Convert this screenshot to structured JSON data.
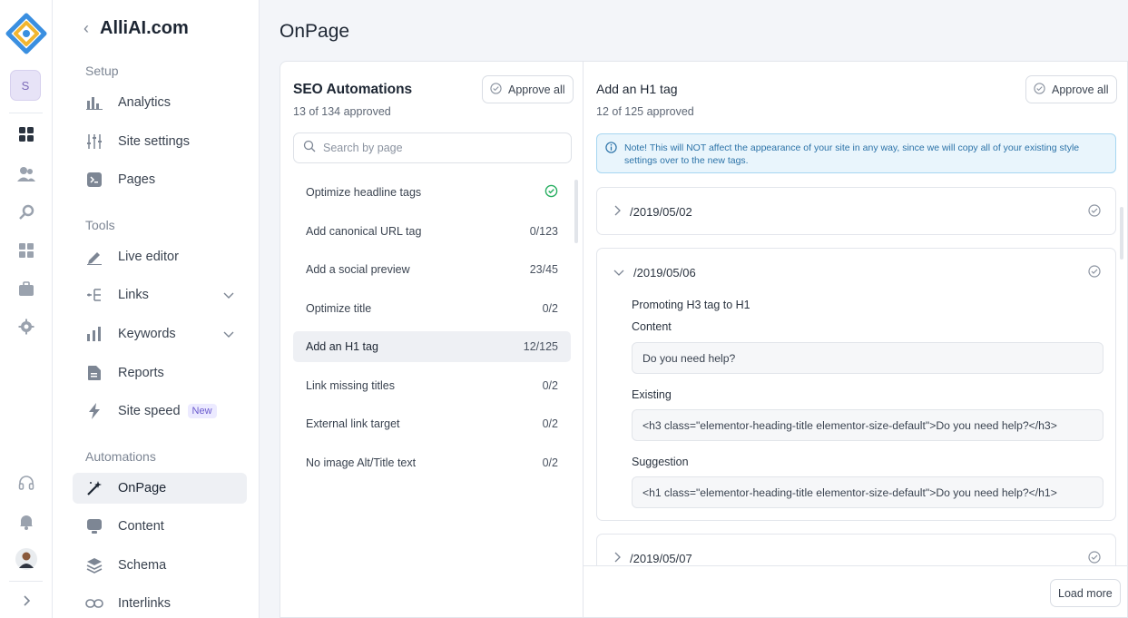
{
  "rail": {
    "workspace_initial": "S"
  },
  "nav": {
    "brand_title": "AlliAI.com",
    "sections": {
      "setup": "Setup",
      "tools": "Tools",
      "automations": "Automations"
    },
    "items": {
      "analytics": "Analytics",
      "site_settings": "Site settings",
      "pages": "Pages",
      "live_editor": "Live editor",
      "links": "Links",
      "keywords": "Keywords",
      "reports": "Reports",
      "site_speed": "Site speed",
      "site_speed_badge": "New",
      "onpage": "OnPage",
      "content": "Content",
      "schema": "Schema",
      "interlinks": "Interlinks"
    }
  },
  "page_title": "OnPage",
  "seo": {
    "title": "SEO Automations",
    "approved": "13 of 134 approved",
    "approve_all": "Approve all",
    "search_placeholder": "Search by page",
    "items": [
      {
        "label": "Optimize headline tags",
        "count": ""
      },
      {
        "label": "Add canonical URL tag",
        "count": "0/123"
      },
      {
        "label": "Add a social preview",
        "count": "23/45"
      },
      {
        "label": "Optimize title",
        "count": "0/2"
      },
      {
        "label": "Add an H1 tag",
        "count": "12/125"
      },
      {
        "label": "Link missing titles",
        "count": "0/2"
      },
      {
        "label": "External link target",
        "count": "0/2"
      },
      {
        "label": "No image Alt/Title text",
        "count": "0/2"
      }
    ]
  },
  "detail": {
    "title": "Add an H1 tag",
    "approved": "12 of 125 approved",
    "approve_all": "Approve all",
    "note_line1": "Note! This will NOT affect the appearance of your site in any way, since we will copy all of your existing style",
    "note_line2": "settings over to the new tags.",
    "pages": [
      "/2019/05/02",
      "/2019/05/06",
      "/2019/05/07"
    ],
    "expanded": {
      "heading": "Promoting H3 tag to H1",
      "content_label": "Content",
      "content_value": "Do you need help?",
      "existing_label": "Existing",
      "existing_value": "<h3 class=\"elementor-heading-title elementor-size-default\">Do you need help?</h3>",
      "suggestion_label": "Suggestion",
      "suggestion_value": "<h1 class=\"elementor-heading-title elementor-size-default\">Do you need help?</h1>"
    },
    "load_more": "Load more"
  },
  "colors": {
    "accent_green": "#27ae60",
    "note_blue": "#2c73a8"
  }
}
